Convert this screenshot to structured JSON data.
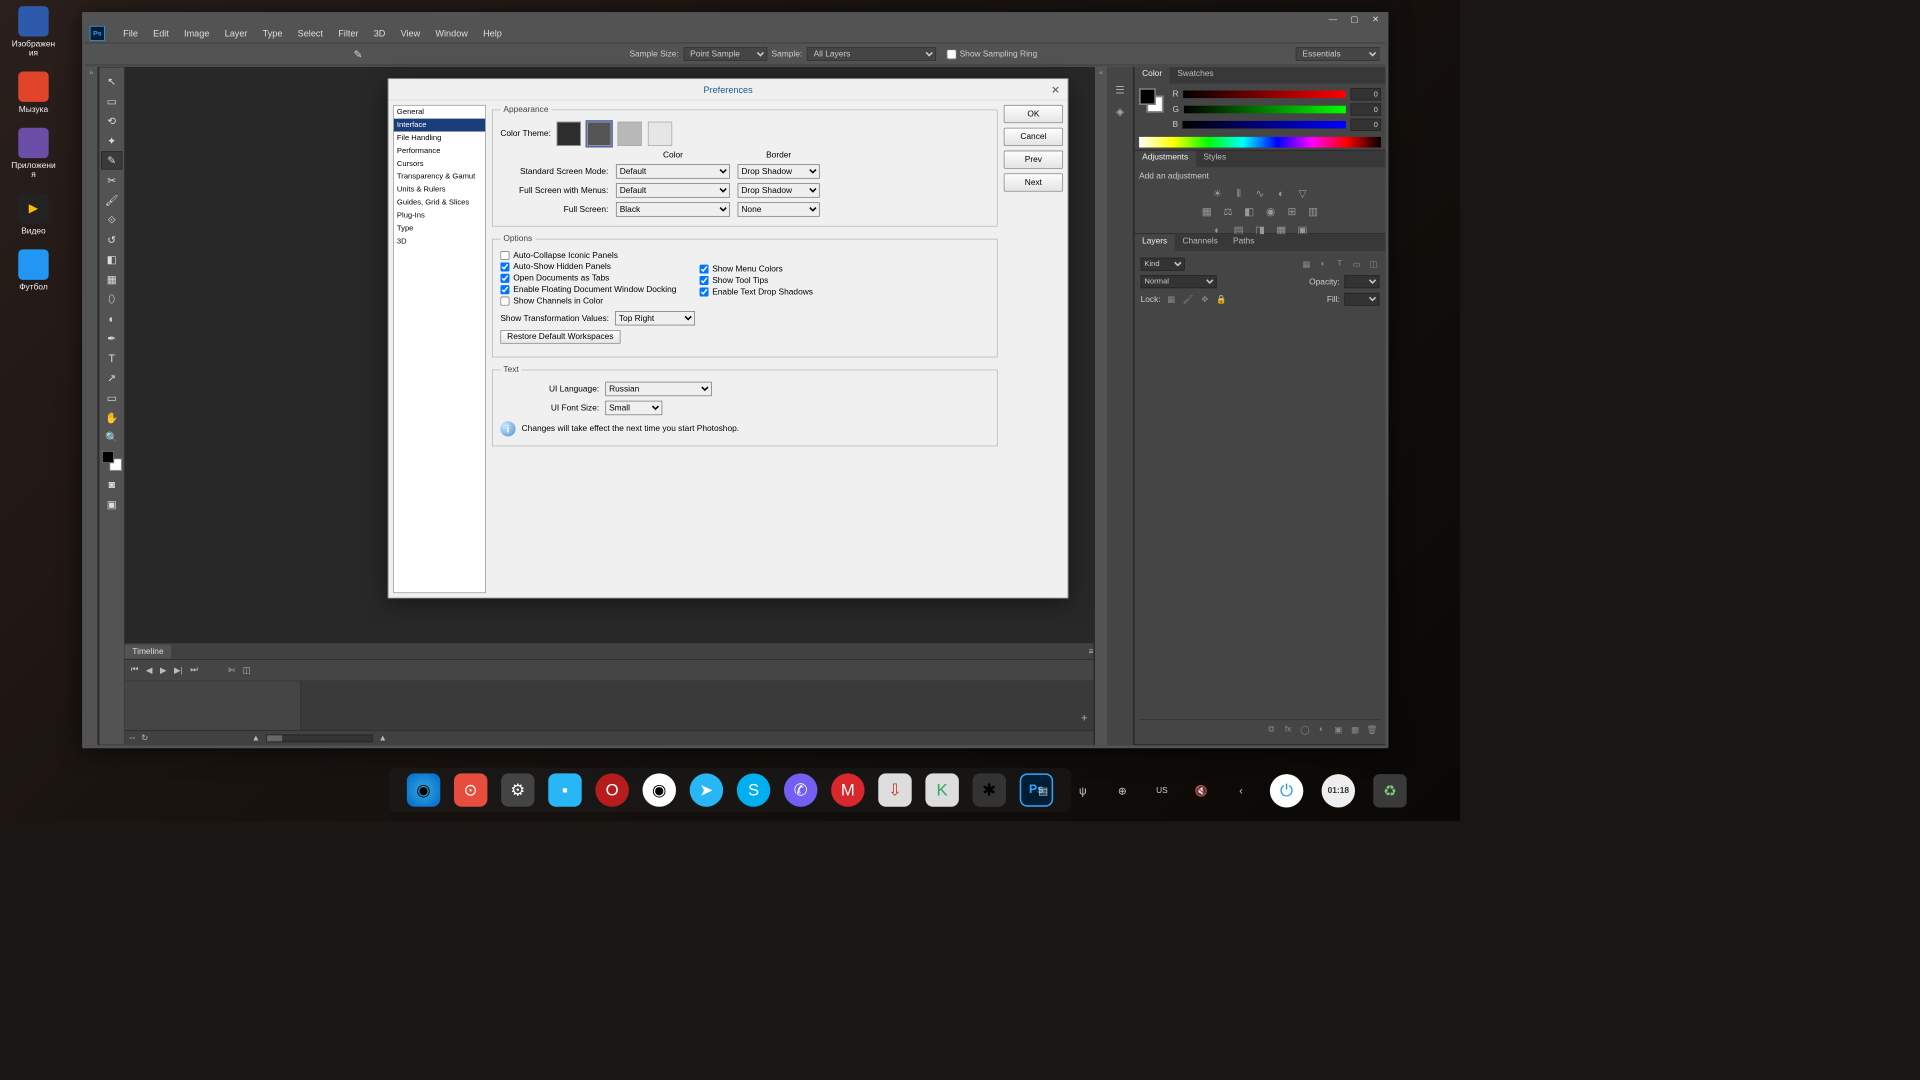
{
  "desktop_icons": [
    {
      "label": "Изображения",
      "color": "#2e5aac"
    },
    {
      "label": "Мызука",
      "color": "#e0452c"
    },
    {
      "label": "Приложения",
      "color": "#6a4ea8"
    },
    {
      "label": "Видео",
      "color": "#222"
    },
    {
      "label": "Футбол",
      "color": "#2196f3"
    }
  ],
  "menu": [
    "File",
    "Edit",
    "Image",
    "Layer",
    "Type",
    "Select",
    "Filter",
    "3D",
    "View",
    "Window",
    "Help"
  ],
  "options_bar": {
    "sample_size_lbl": "Sample Size:",
    "sample_size": "Point Sample",
    "sample_lbl": "Sample:",
    "sample": "All Layers",
    "show_ring": "Show Sampling Ring",
    "workspace": "Essentials"
  },
  "timeline": {
    "tab": "Timeline"
  },
  "color_panel": {
    "tabs": [
      "Color",
      "Swatches"
    ],
    "r": "R",
    "g": "G",
    "b": "B",
    "rv": "0",
    "gv": "0",
    "bv": "0"
  },
  "adjustments": {
    "tabs": [
      "Adjustments",
      "Styles"
    ],
    "label": "Add an adjustment"
  },
  "layers": {
    "tabs": [
      "Layers",
      "Channels",
      "Paths"
    ],
    "kind": "Kind",
    "blend": "Normal",
    "opacity": "Opacity:",
    "lock": "Lock:",
    "fill": "Fill:"
  },
  "prefs": {
    "title": "Preferences",
    "nav": [
      "General",
      "Interface",
      "File Handling",
      "Performance",
      "Cursors",
      "Transparency & Gamut",
      "Units & Rulers",
      "Guides, Grid & Slices",
      "Plug-Ins",
      "Type",
      "3D"
    ],
    "nav_selected": 1,
    "buttons": {
      "ok": "OK",
      "cancel": "Cancel",
      "prev": "Prev",
      "next": "Next"
    },
    "appearance": {
      "legend": "Appearance",
      "theme_lbl": "Color Theme:",
      "col_color": "Color",
      "col_border": "Border",
      "std_lbl": "Standard Screen Mode:",
      "std_color": "Default",
      "std_border": "Drop Shadow",
      "menus_lbl": "Full Screen with Menus:",
      "menus_color": "Default",
      "menus_border": "Drop Shadow",
      "full_lbl": "Full Screen:",
      "full_color": "Black",
      "full_border": "None"
    },
    "options": {
      "legend": "Options",
      "auto_collapse": "Auto-Collapse Iconic Panels",
      "auto_show": "Auto-Show Hidden Panels",
      "open_tabs": "Open Documents as Tabs",
      "floating": "Enable Floating Document Window Docking",
      "channels": "Show Channels in Color",
      "menu_colors": "Show Menu Colors",
      "tooltips": "Show Tool Tips",
      "drop": "Enable Text Drop Shadows",
      "trans_lbl": "Show Transformation Values:",
      "trans_val": "Top Right",
      "restore": "Restore Default Workspaces"
    },
    "text": {
      "legend": "Text",
      "lang_lbl": "UI Language:",
      "lang": "Russian",
      "font_lbl": "UI Font Size:",
      "font": "Small",
      "info": "Changes will take effect the next time you start Photoshop."
    }
  },
  "tray": {
    "lang": "US",
    "time": "01:18"
  }
}
